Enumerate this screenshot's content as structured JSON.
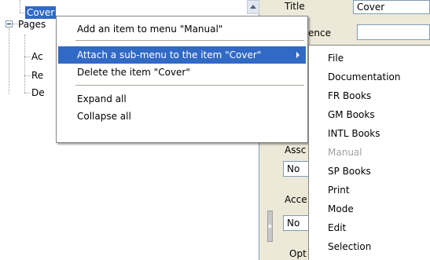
{
  "tree": {
    "cover": "Cover",
    "pages": "Pages",
    "child1": "Ac",
    "child2": "Re",
    "child3": "De"
  },
  "right_panel": {
    "title_label": "Title",
    "title_value": "Cover",
    "reference_label": "ence",
    "reference_value": "",
    "assoc_label": "Assc",
    "assoc_value": "No",
    "access_label": "Acce",
    "access_value": "No",
    "options_label": "Opt"
  },
  "context_menu": {
    "items": [
      "Add an item to menu \"Manual\"",
      "Attach a sub-menu to the item \"Cover\"",
      "Delete the item \"Cover\"",
      "Expand all",
      "Collapse all"
    ]
  },
  "submenu": {
    "items": [
      "File",
      "Documentation",
      "FR Books",
      "GM Books",
      "INTL Books",
      "Manual",
      "SP Books",
      "Print",
      "Mode",
      "Edit",
      "Selection"
    ]
  },
  "colors": {
    "highlight": "#316ac5",
    "disabled_text": "#a0a0a0"
  }
}
